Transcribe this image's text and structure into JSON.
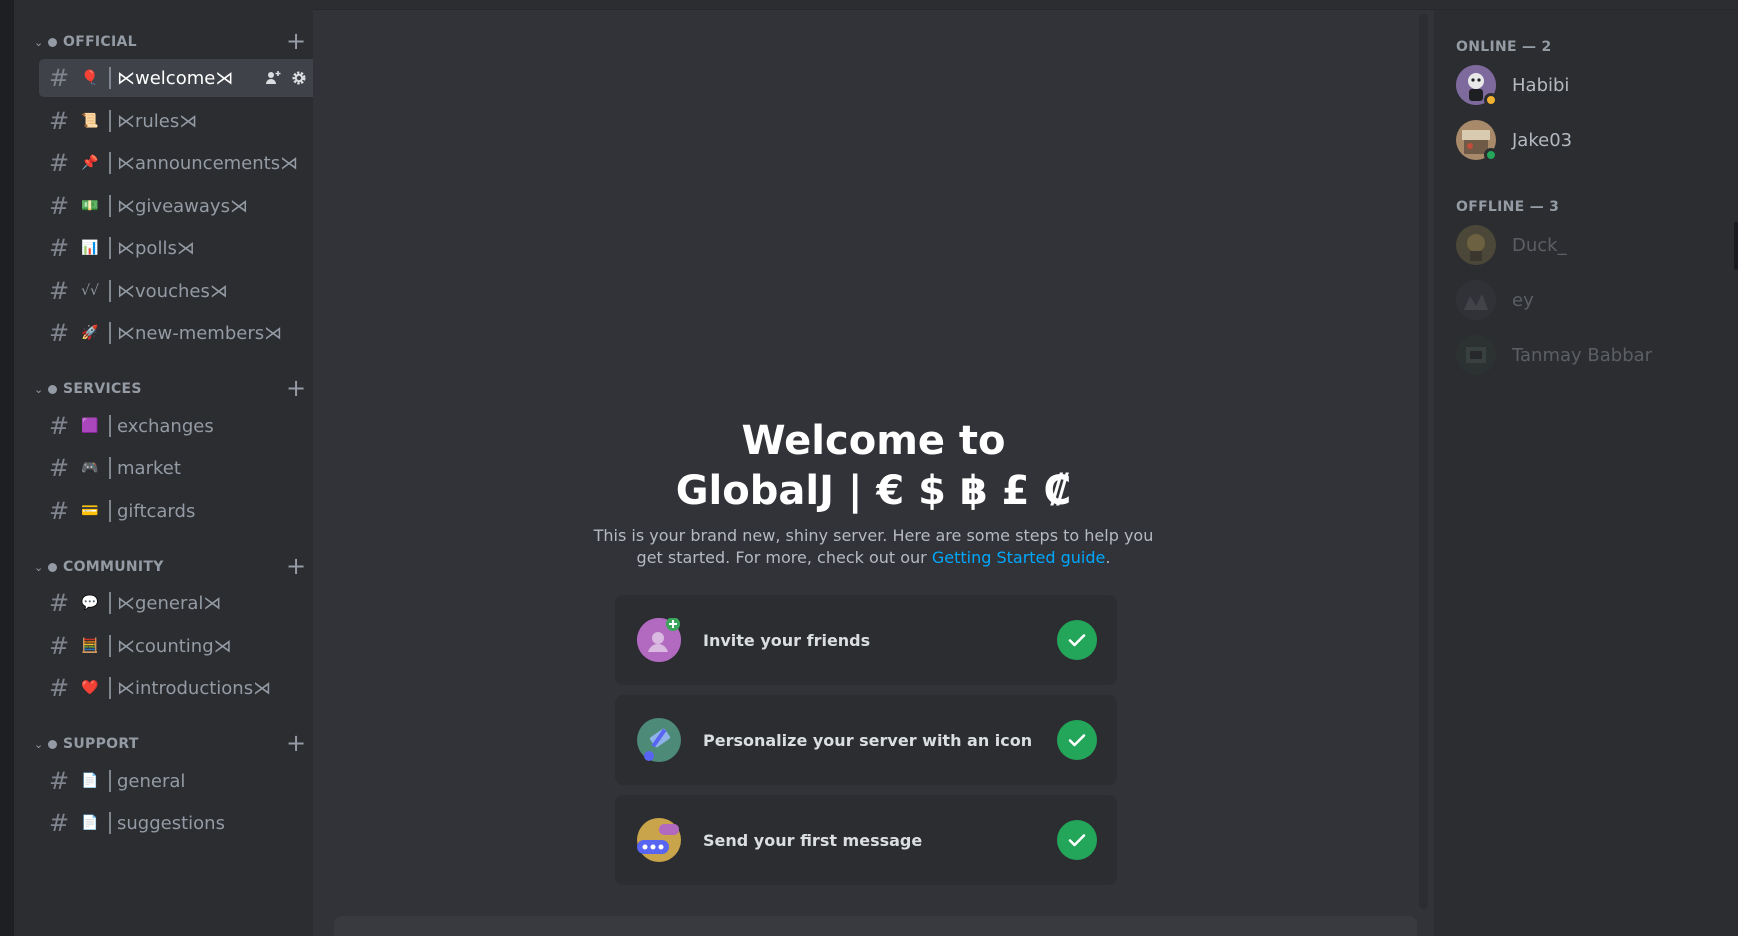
{
  "sidebar": {
    "categories": [
      {
        "label": "OFFICIAL"
      },
      {
        "label": "SERVICES"
      },
      {
        "label": "COMMUNITY"
      },
      {
        "label": "SUPPORT"
      }
    ],
    "channels": [
      {
        "emoji": "🎈",
        "name": "⋉welcome⋊"
      },
      {
        "emoji": "📜",
        "name": "⋉rules⋊"
      },
      {
        "emoji": "📌",
        "name": "⋉announcements⋊"
      },
      {
        "emoji": "💵",
        "name": "⋉giveaways⋊"
      },
      {
        "emoji": "📊",
        "name": "⋉polls⋊"
      },
      {
        "emoji": "√√",
        "name": "⋉vouches⋊"
      },
      {
        "emoji": "🚀",
        "name": "⋉new-members⋊"
      },
      {
        "emoji": "🟪",
        "name": "exchanges"
      },
      {
        "emoji": "🎮",
        "name": "market"
      },
      {
        "emoji": "💳",
        "name": "giftcards"
      },
      {
        "emoji": "💬",
        "name": "⋉general⋊"
      },
      {
        "emoji": "🧮",
        "name": "⋉counting⋊"
      },
      {
        "emoji": "❤️",
        "name": "⋉introductions⋊"
      },
      {
        "emoji": "📄",
        "name": "general"
      },
      {
        "emoji": "📄",
        "name": "suggestions"
      }
    ],
    "hash": "#",
    "plus": "+",
    "chevron": "⌄"
  },
  "main": {
    "title_line1": "Welcome to",
    "title_line2": "GlobalJ | € $ ฿ £ ₡",
    "desc_line1": "This is your brand new, shiny server. Here are some steps to help you",
    "desc_line2_prefix": "get started. For more, check out our ",
    "desc_link": "Getting Started guide",
    "desc_suffix": ".",
    "tasks": [
      {
        "label": "Invite your friends",
        "icon": "invite-friends-icon"
      },
      {
        "label": "Personalize your server with an icon",
        "icon": "personalize-icon"
      },
      {
        "label": "Send your first message",
        "icon": "message-icon"
      }
    ]
  },
  "members": {
    "online_header": "ONLINE — 2",
    "offline_header": "OFFLINE — 3",
    "online": [
      {
        "name": "Habibi",
        "status_color": "#f0b232"
      },
      {
        "name": "Jake03",
        "status_color": "#23a55a"
      }
    ],
    "offline": [
      {
        "name": "Duck_"
      },
      {
        "name": "ey"
      },
      {
        "name": "Tanmay Babbar"
      }
    ]
  },
  "colors": {
    "accent_link": "#00a8fc",
    "success": "#23a55a",
    "idle": "#f0b232"
  }
}
